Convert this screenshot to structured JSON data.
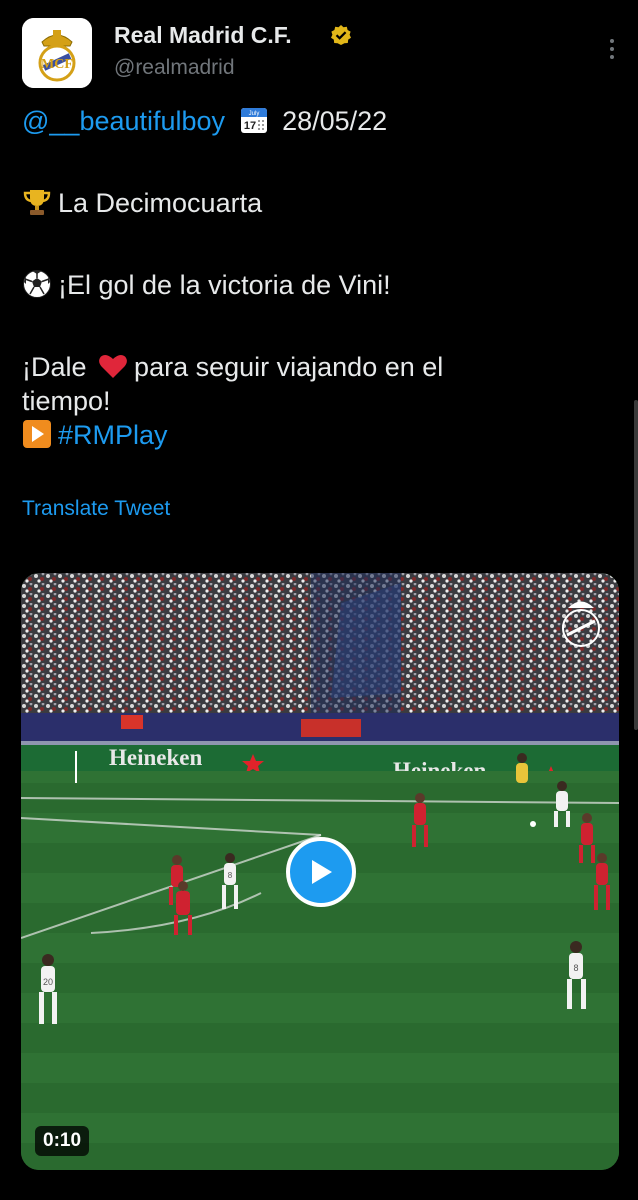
{
  "tweet": {
    "author_name": "Real Madrid C.F.",
    "handle": "@realmadrid",
    "mention": "@__beautifulboy",
    "date": "28/05/22",
    "line2": "La Decimocuarta",
    "line3": "¡El gol de la victoria de Vini!",
    "line4a": "¡Dale",
    "line4b": "para seguir viajando en el",
    "line5": "tiempo!",
    "hashtag": "#RMPlay",
    "translate_label": "Translate Tweet"
  },
  "calendar_icon": {
    "month": "July",
    "day": "17"
  },
  "ads": {
    "board1": "Heineken",
    "board2": "Heineken"
  },
  "players": {
    "p1": "8",
    "p2": "20",
    "p3": "8"
  },
  "video": {
    "duration": "0:10"
  },
  "colors": {
    "accent": "#1d9bf0",
    "background": "#000000",
    "text": "#e7e9ea",
    "muted": "#71767b"
  },
  "icons": [
    "verified-badge-icon",
    "more-options-icon",
    "calendar-icon",
    "trophy-icon",
    "soccer-ball-icon",
    "heart-icon",
    "play-button-icon",
    "real-madrid-crest-icon"
  ]
}
